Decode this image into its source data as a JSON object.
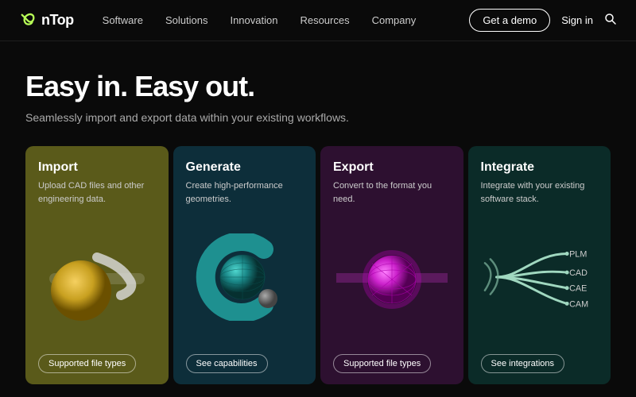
{
  "nav": {
    "logo_text": "nTop",
    "links": [
      "Software",
      "Solutions",
      "Innovation",
      "Resources",
      "Company"
    ],
    "demo_btn": "Get a demo",
    "signin": "Sign in"
  },
  "hero": {
    "title": "Easy in. Easy out.",
    "subtitle": "Seamlessly import and export data within your existing workflows."
  },
  "cards": [
    {
      "id": "import",
      "title": "Import",
      "desc": "Upload CAD files and other engineering data.",
      "btn": "Supported file types",
      "color": "#5a5a1a"
    },
    {
      "id": "generate",
      "title": "Generate",
      "desc": "Create high-performance geometries.",
      "btn": "See capabilities",
      "color": "#0d2e3a"
    },
    {
      "id": "export",
      "title": "Export",
      "desc": "Convert to the format you need.",
      "btn": "Supported file types",
      "color": "#2d1030"
    },
    {
      "id": "integrate",
      "title": "Integrate",
      "desc": "Integrate with your existing software stack.",
      "btn": "See integrations",
      "color": "#0b2b28",
      "labels": [
        "PLM",
        "CAD",
        "CAE",
        "CAM"
      ]
    }
  ]
}
